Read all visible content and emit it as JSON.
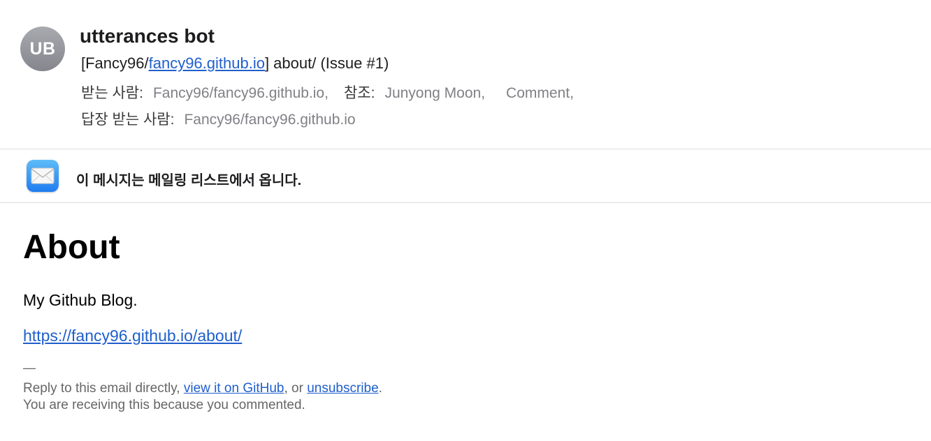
{
  "header": {
    "avatar_initials": "UB",
    "sender": "utterances bot",
    "subject": {
      "prefix": "[Fancy96/",
      "repo_link": "fancy96.github.io",
      "suffix": "] about/ (Issue #1)"
    },
    "to_label": "받는 사람:",
    "to_value": "Fancy96/fancy96.github.io,",
    "cc_label": "참조:",
    "cc_values": [
      "Junyong Moon,",
      "Comment,"
    ],
    "reply_to_label": "답장 받는 사람:",
    "reply_to_value": "Fancy96/fancy96.github.io"
  },
  "banner": {
    "icon": "mail-icon",
    "text": "이 메시지는 메일링 리스트에서 옵니다."
  },
  "body": {
    "heading": "About",
    "paragraph": "My Github Blog.",
    "link": "https://fancy96.github.io/about/",
    "separator": "—",
    "footer": {
      "reply_prefix": "Reply to this email directly, ",
      "view_link": "view it on GitHub",
      "middle": ", or ",
      "unsubscribe_link": "unsubscribe",
      "end": ".",
      "receiving": "You are receiving this because you commented."
    }
  },
  "colors": {
    "link": "#1f5fcc",
    "muted": "#808086",
    "footer": "#666666"
  }
}
